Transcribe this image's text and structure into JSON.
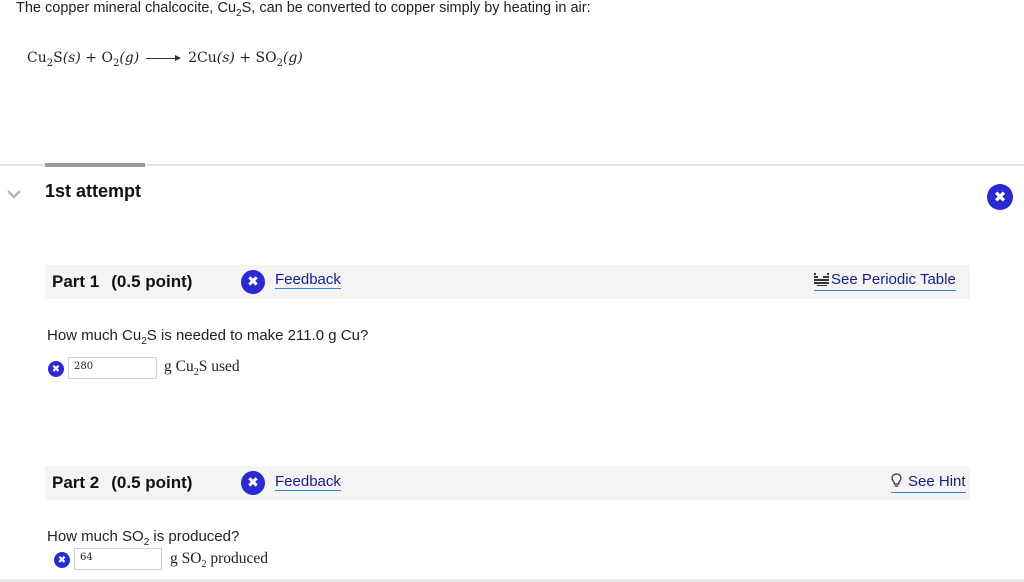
{
  "intro": {
    "text_before": "The copper mineral chalcocite, Cu",
    "text_sub": "2",
    "text_after": "S, can be converted to copper simply by heating in air:"
  },
  "equation": {
    "r1": "Cu",
    "r1_sub": "2",
    "r1_rest": "S",
    "r1_phase": "(s)",
    "plus1": "+",
    "r2": "O",
    "r2_sub": "2",
    "r2_phase": "(g)",
    "p1": "2Cu",
    "p1_phase": "(s)",
    "plus2": "+",
    "p2": "SO",
    "p2_sub": "2",
    "p2_phase": "(g)"
  },
  "attempt": {
    "title": "1st attempt",
    "status_glyph": "✖"
  },
  "part1": {
    "title": "Part 1",
    "points": "(0.5 point)",
    "feedback_label": "Feedback",
    "right_label": "See Periodic Table",
    "right_icon": "periodic-table-icon",
    "question_before": "How much Cu",
    "question_sub": "2",
    "question_after": "S is needed to make 211.0 g Cu?",
    "answer_value": "280",
    "unit_before": "g Cu",
    "unit_sub": "2",
    "unit_after": "S used"
  },
  "part2": {
    "title": "Part 2",
    "points": "(0.5 point)",
    "feedback_label": "Feedback",
    "right_label": "See Hint",
    "right_icon": "lightbulb-icon",
    "question_before": "How much SO",
    "question_sub": "2",
    "question_after": " is produced?",
    "answer_value": "64",
    "unit_before": "g SO",
    "unit_sub": "2",
    "unit_after": " produced"
  },
  "colors": {
    "status_blue": "#2a2ad0",
    "link_underline": "#2c8bd8",
    "part_bar_bg": "#f4f4f4"
  }
}
